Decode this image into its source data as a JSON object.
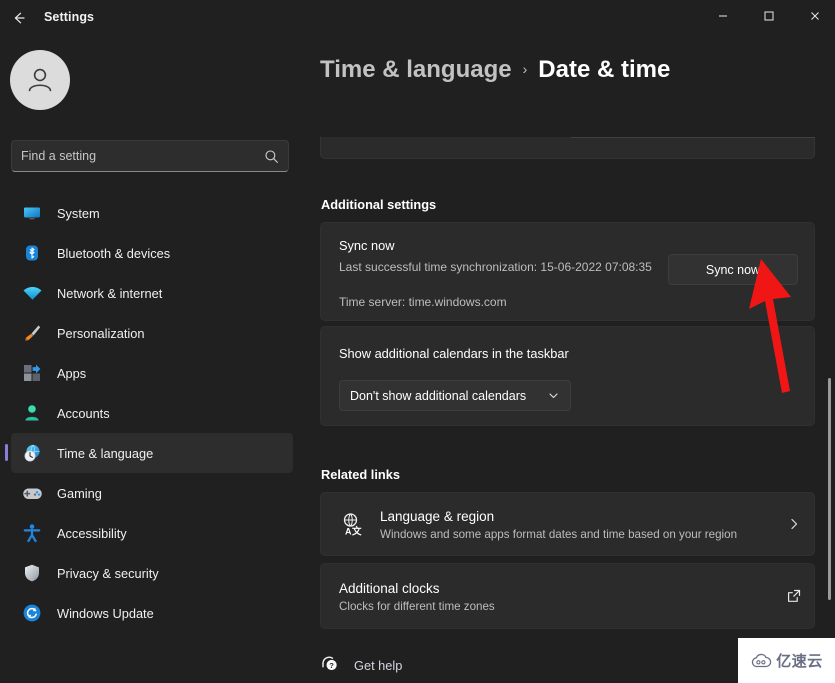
{
  "window": {
    "app_title": "Settings",
    "back_icon": "back-arrow-icon",
    "minimize_label": "–",
    "maximize_label": "☐",
    "close_label": "✕"
  },
  "sidebar": {
    "avatar_icon": "user-avatar-icon",
    "search": {
      "placeholder": "Find a setting",
      "value": "",
      "icon": "search-icon"
    },
    "items": [
      {
        "label": "System",
        "icon": "monitor-icon",
        "active": false
      },
      {
        "label": "Bluetooth & devices",
        "icon": "bluetooth-icon",
        "active": false
      },
      {
        "label": "Network & internet",
        "icon": "wifi-icon",
        "active": false
      },
      {
        "label": "Personalization",
        "icon": "paintbrush-icon",
        "active": false
      },
      {
        "label": "Apps",
        "icon": "apps-grid-icon",
        "active": false
      },
      {
        "label": "Accounts",
        "icon": "person-icon",
        "active": false
      },
      {
        "label": "Time & language",
        "icon": "clock-globe-icon",
        "active": true
      },
      {
        "label": "Gaming",
        "icon": "gamepad-icon",
        "active": false
      },
      {
        "label": "Accessibility",
        "icon": "accessibility-icon",
        "active": false
      },
      {
        "label": "Privacy & security",
        "icon": "shield-icon",
        "active": false
      },
      {
        "label": "Windows Update",
        "icon": "update-sync-icon",
        "active": false
      }
    ]
  },
  "breadcrumb": {
    "parent": "Time & language",
    "separator": "›",
    "current": "Date & time"
  },
  "main": {
    "additional_settings_heading": "Additional settings",
    "sync_card": {
      "title": "Sync now",
      "subtitle": "Last successful time synchronization: 15-06-2022 07:08:35",
      "time_server": "Time server: time.windows.com",
      "button_label": "Sync now"
    },
    "calendar_card": {
      "title": "Show additional calendars in the taskbar",
      "selected_option": "Don't show additional calendars",
      "chevron_icon": "chevron-down-icon"
    },
    "related_links_heading": "Related links",
    "related_links": [
      {
        "title": "Language & region",
        "subtitle": "Windows and some apps format dates and time based on your region",
        "icon": "translate-globe-icon",
        "action_icon": "chevron-right-icon"
      },
      {
        "title": "Additional clocks",
        "subtitle": "Clocks for different time zones",
        "icon": "",
        "action_icon": "open-external-icon"
      }
    ],
    "get_help": {
      "label": "Get help",
      "icon": "help-question-icon"
    }
  },
  "annotation": {
    "arrow_color": "#f01616",
    "arrow_points_to": "sync-now-button"
  },
  "watermark": {
    "text": "亿速云",
    "icon": "cloud-icon"
  },
  "colors": {
    "window_bg": "#202020",
    "card_bg": "#2b2b2b",
    "accent": "#8a7fd4",
    "annotation_red": "#f01616"
  }
}
